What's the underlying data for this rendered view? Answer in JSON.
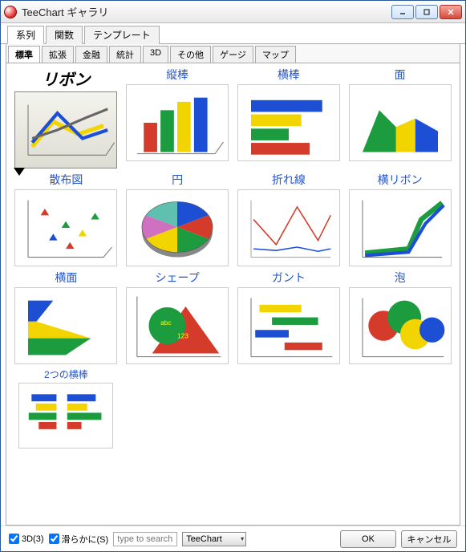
{
  "window": {
    "title": "TeeChart ギャラリ"
  },
  "maintabs": [
    {
      "label": "系列",
      "active": true
    },
    {
      "label": "関数"
    },
    {
      "label": "テンプレート"
    }
  ],
  "subtabs": [
    {
      "label": "標準",
      "active": true
    },
    {
      "label": "拡張"
    },
    {
      "label": "金融"
    },
    {
      "label": "統計"
    },
    {
      "label": "3D"
    },
    {
      "label": "その他"
    },
    {
      "label": "ゲージ"
    },
    {
      "label": "マップ"
    }
  ],
  "gallery": [
    {
      "label": "リボン",
      "selected": true
    },
    {
      "label": "縦棒"
    },
    {
      "label": "横棒"
    },
    {
      "label": "面"
    },
    {
      "label": "散布図"
    },
    {
      "label": "円"
    },
    {
      "label": "折れ線"
    },
    {
      "label": "横リボン"
    },
    {
      "label": "横面"
    },
    {
      "label": "シェープ"
    },
    {
      "label": "ガント"
    },
    {
      "label": "泡"
    },
    {
      "label": "2つの横棒"
    }
  ],
  "bottom": {
    "chk3d": "3D(3)",
    "chkSmooth": "滑らかに(S)",
    "searchPlaceholder": "type to search",
    "theme": "TeeChart",
    "ok": "OK",
    "cancel": "キャンセル"
  },
  "colors": {
    "red": "#d43b2a",
    "green": "#1c9b3f",
    "blue": "#1c4fd4",
    "yellow": "#f2d500"
  }
}
